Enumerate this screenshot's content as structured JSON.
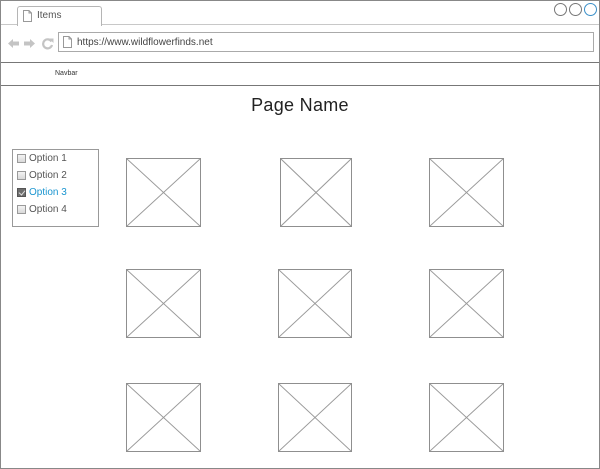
{
  "browser": {
    "tab_title": "Items",
    "url": "https://www.wildflowerfinds.net",
    "icons": [
      "document-icon",
      "back-arrow-icon",
      "forward-arrow-icon",
      "reload-icon"
    ],
    "window_buttons": 3
  },
  "navbar": {
    "label": "Navbar"
  },
  "page": {
    "title": "Page Name"
  },
  "filter": {
    "options": [
      {
        "label": "Option 1",
        "checked": false
      },
      {
        "label": "Option 2",
        "checked": false
      },
      {
        "label": "Option 3",
        "checked": true
      },
      {
        "label": "Option 4",
        "checked": false
      }
    ],
    "selected_color": "#1a95d0"
  },
  "grid": {
    "image_placeholder_count": 9
  }
}
